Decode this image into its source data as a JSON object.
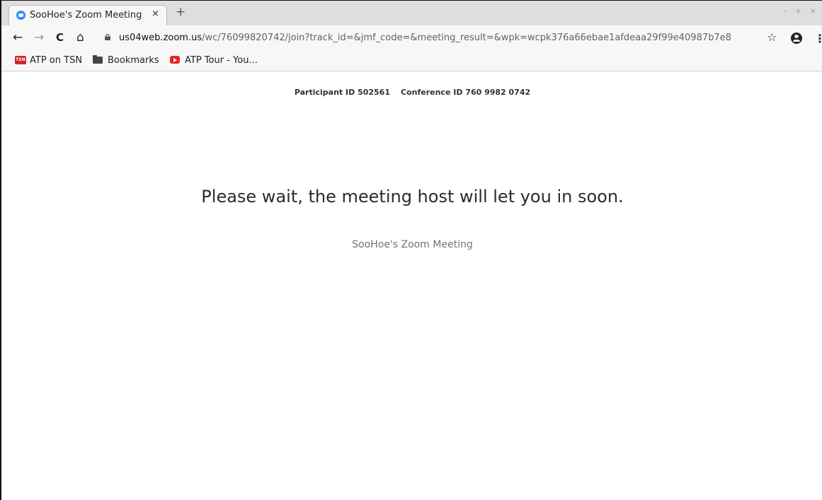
{
  "browser": {
    "tab": {
      "title": "SooHoe's Zoom Meeting",
      "close_label": "×",
      "favicon": "zoom-icon"
    },
    "new_tab_label": "+",
    "window_controls": "– + ×",
    "nav": {
      "back": "←",
      "forward": "→",
      "reload": "C",
      "home": "⌂"
    },
    "url_host": "us04web.zoom.us",
    "url_path": "/wc/76099820742/join?track_id=&jmf_code=&meeting_result=&wpk=wcpk376a66ebae1afdeaa29f99e40987b7e8",
    "bookmark_star": "☆",
    "menu": "⋮",
    "bookmarks": [
      {
        "label": "ATP on TSN",
        "icon": "tsn-icon",
        "icon_text": "TSN"
      },
      {
        "label": "Bookmarks",
        "icon": "folder-icon"
      },
      {
        "label": "ATP Tour - You...",
        "icon": "youtube-icon"
      }
    ]
  },
  "page": {
    "participant_id": "Participant ID 502561",
    "conference_id": "Conference ID 760 9982 0742",
    "wait_message": "Please wait, the meeting host will let you in soon.",
    "meeting_name": "SooHoe's Zoom Meeting"
  },
  "colors": {
    "zoom_blue": "#2d8cff",
    "tsn_red": "#d2232a",
    "youtube_red": "#e52420"
  }
}
